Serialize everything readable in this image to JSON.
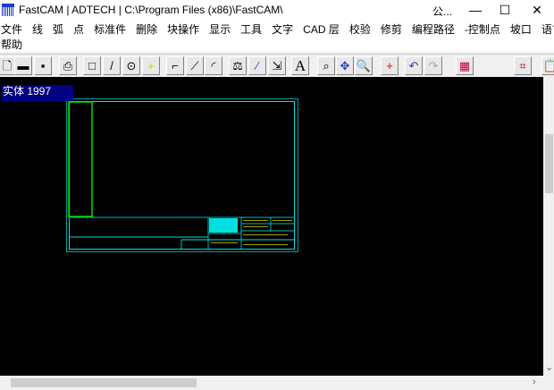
{
  "window": {
    "title": "FastCAM  |  ADTECH  |  C:\\Program Files (x86)\\FastCAM\\",
    "extra": "公...",
    "minimize": "—",
    "maximize": "☐",
    "close": "✕"
  },
  "menu": {
    "row1": [
      "文件",
      "线",
      "弧",
      "点",
      "标准件",
      "删除",
      "块操作",
      "显示",
      "工具",
      "文字",
      "CAD 层",
      "校验",
      "修剪",
      "编程路径",
      "-控制点",
      "坡口",
      "语言"
    ],
    "row2": [
      "帮助"
    ]
  },
  "toolbar": [
    {
      "icon": "new-file-icon",
      "glyph": "🗋"
    },
    {
      "icon": "open-folder-icon",
      "glyph": "▬"
    },
    {
      "icon": "save-icon",
      "glyph": "▪"
    },
    {
      "icon": "print-icon",
      "glyph": "⎙"
    },
    {
      "icon": "rectangle-icon",
      "glyph": "□"
    },
    {
      "icon": "line-icon",
      "glyph": "/"
    },
    {
      "icon": "circle-icon",
      "glyph": "⊙"
    },
    {
      "icon": "point-icon",
      "glyph": "+"
    },
    {
      "icon": "corner-icon",
      "glyph": "⌐"
    },
    {
      "icon": "chamfer-icon",
      "glyph": "⟋"
    },
    {
      "icon": "fillet-icon",
      "glyph": "◜"
    },
    {
      "icon": "measure-icon",
      "glyph": "⚖"
    },
    {
      "icon": "trim-icon",
      "glyph": "⁄"
    },
    {
      "icon": "export-icon",
      "glyph": "⇲"
    },
    {
      "icon": "text-icon",
      "glyph": "A"
    },
    {
      "icon": "zoom-window-icon",
      "glyph": "⌕"
    },
    {
      "icon": "zoom-extents-icon",
      "glyph": "✥"
    },
    {
      "icon": "zoom-icon",
      "glyph": "🔍"
    },
    {
      "icon": "add-point-icon",
      "glyph": "+"
    },
    {
      "icon": "undo-icon",
      "glyph": "↶"
    },
    {
      "icon": "redo-icon",
      "glyph": "↷"
    },
    {
      "icon": "nesting-icon",
      "glyph": "▦"
    },
    {
      "icon": "path-icon",
      "glyph": "⌗"
    },
    {
      "icon": "clipboard-icon",
      "glyph": "📋"
    }
  ],
  "status": {
    "text": "实体  1997"
  },
  "drawing_logo": "FastCAM",
  "colors": {
    "border": "#00c8c8",
    "green": "#00e000",
    "status_bg": "#000080"
  }
}
